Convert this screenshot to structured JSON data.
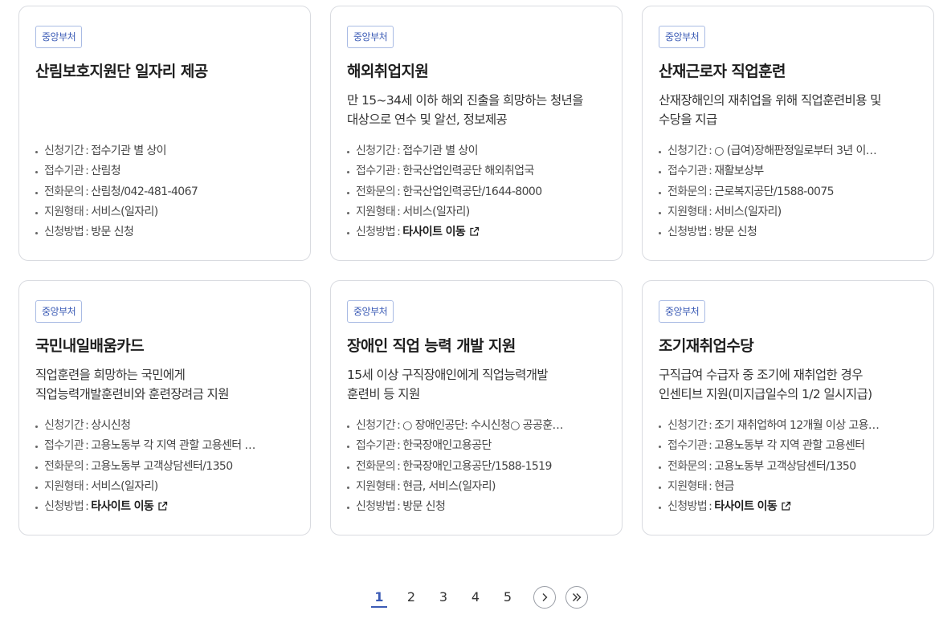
{
  "cards": [
    {
      "badge": "중앙부처",
      "title": "산림보호지원단 일자리 제공",
      "desc_lines": [
        "",
        ""
      ],
      "details": [
        {
          "label": "신청기간",
          "value": "접수기관 별 상이",
          "link": false
        },
        {
          "label": "접수기관",
          "value": "산림청",
          "link": false
        },
        {
          "label": "전화문의",
          "value": "산림청/042-481-4067",
          "link": false
        },
        {
          "label": "지원형태",
          "value": "서비스(일자리)",
          "link": false
        },
        {
          "label": "신청방법",
          "value": "방문 신청",
          "link": false
        }
      ]
    },
    {
      "badge": "중앙부처",
      "title": "해외취업지원",
      "desc_lines": [
        "만 15~34세 이하 해외 진출을 희망하는 청년을",
        "대상으로 연수 및 알선, 정보제공"
      ],
      "details": [
        {
          "label": "신청기간",
          "value": "접수기관 별 상이",
          "link": false
        },
        {
          "label": "접수기관",
          "value": "한국산업인력공단 해외취업국",
          "link": false
        },
        {
          "label": "전화문의",
          "value": "한국산업인력공단/1644-8000",
          "link": false
        },
        {
          "label": "지원형태",
          "value": "서비스(일자리)",
          "link": false
        },
        {
          "label": "신청방법",
          "value": "타사이트 이동",
          "link": true
        }
      ]
    },
    {
      "badge": "중앙부처",
      "title": "산재근로자 직업훈련",
      "desc_lines": [
        "산재장해인의 재취업을 위해 직업훈련비용 및",
        "수당을 지급"
      ],
      "details": [
        {
          "label": "신청기간",
          "value": "○ (급여)장해판정일로부터 3년 이…",
          "link": false
        },
        {
          "label": "접수기관",
          "value": "재활보상부",
          "link": false
        },
        {
          "label": "전화문의",
          "value": "근로복지공단/1588-0075",
          "link": false
        },
        {
          "label": "지원형태",
          "value": "서비스(일자리)",
          "link": false
        },
        {
          "label": "신청방법",
          "value": "방문 신청",
          "link": false
        }
      ]
    },
    {
      "badge": "중앙부처",
      "title": "국민내일배움카드",
      "desc_lines": [
        "직업훈련을 희망하는 국민에게",
        "직업능력개발훈련비와 훈련장려금 지원"
      ],
      "details": [
        {
          "label": "신청기간",
          "value": "상시신청",
          "link": false
        },
        {
          "label": "접수기관",
          "value": "고용노동부 각 지역 관할 고용센터 …",
          "link": false
        },
        {
          "label": "전화문의",
          "value": "고용노동부 고객상담센터/1350",
          "link": false
        },
        {
          "label": "지원형태",
          "value": "서비스(일자리)",
          "link": false
        },
        {
          "label": "신청방법",
          "value": "타사이트 이동",
          "link": true
        }
      ]
    },
    {
      "badge": "중앙부처",
      "title": "장애인 직업 능력 개발 지원",
      "desc_lines": [
        "15세 이상 구직장애인에게 직업능력개발",
        "훈련비 등 지원"
      ],
      "details": [
        {
          "label": "신청기간",
          "value": "○ 장애인공단: 수시신청○ 공공훈…",
          "link": false
        },
        {
          "label": "접수기관",
          "value": "한국장애인고용공단",
          "link": false
        },
        {
          "label": "전화문의",
          "value": "한국장애인고용공단/1588-1519",
          "link": false
        },
        {
          "label": "지원형태",
          "value": "현금, 서비스(일자리)",
          "link": false
        },
        {
          "label": "신청방법",
          "value": "방문 신청",
          "link": false
        }
      ]
    },
    {
      "badge": "중앙부처",
      "title": "조기재취업수당",
      "desc_lines": [
        "구직급여 수급자 중 조기에 재취업한 경우",
        "인센티브 지원(미지급일수의 1/2 일시지급)"
      ],
      "details": [
        {
          "label": "신청기간",
          "value": "조기 재취업하여 12개월 이상 고용…",
          "link": false
        },
        {
          "label": "접수기관",
          "value": "고용노동부 각 지역 관할 고용센터",
          "link": false
        },
        {
          "label": "전화문의",
          "value": "고용노동부 고객상담센터/1350",
          "link": false
        },
        {
          "label": "지원형태",
          "value": "현금",
          "link": false
        },
        {
          "label": "신청방법",
          "value": "타사이트 이동",
          "link": true
        }
      ]
    }
  ],
  "pagination": {
    "pages": [
      "1",
      "2",
      "3",
      "4",
      "5"
    ],
    "current": "1"
  }
}
